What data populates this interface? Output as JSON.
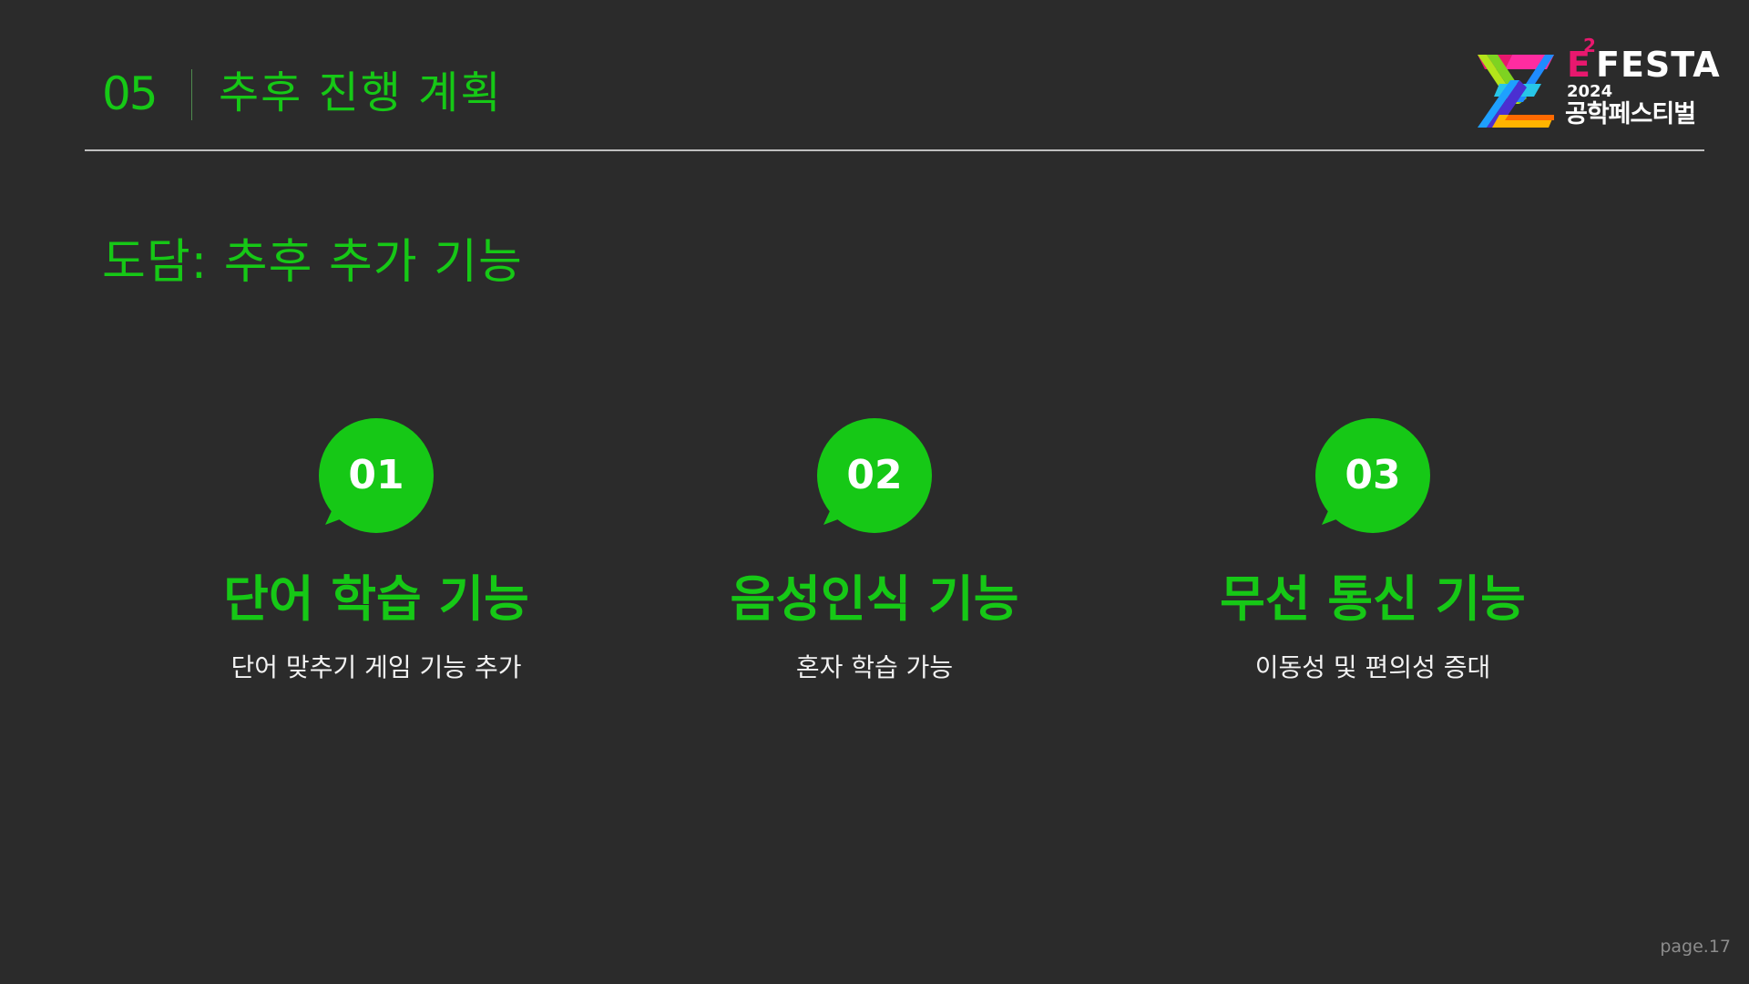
{
  "header": {
    "section_number": "05",
    "section_title": "추후 진행 계획"
  },
  "logo": {
    "letter": "E",
    "superscript": "2",
    "name": "FESTA",
    "year": "2024",
    "korean_name": "공학페스티벌"
  },
  "subtitle": "도담: 추후 추가 기능",
  "features": [
    {
      "number": "01",
      "title": "단어 학습 기능",
      "description": "단어 맞추기 게임 기능 추가"
    },
    {
      "number": "02",
      "title": "음성인식 기능",
      "description": "혼자 학습 가능"
    },
    {
      "number": "03",
      "title": "무선 통신 기능",
      "description": "이동성 및 편의성 증대"
    }
  ],
  "page_label": "page.17",
  "colors": {
    "background": "#2b2b2b",
    "accent_green": "#16c816",
    "rule": "#bfbfbf",
    "logo_pink": "#e8186e"
  }
}
